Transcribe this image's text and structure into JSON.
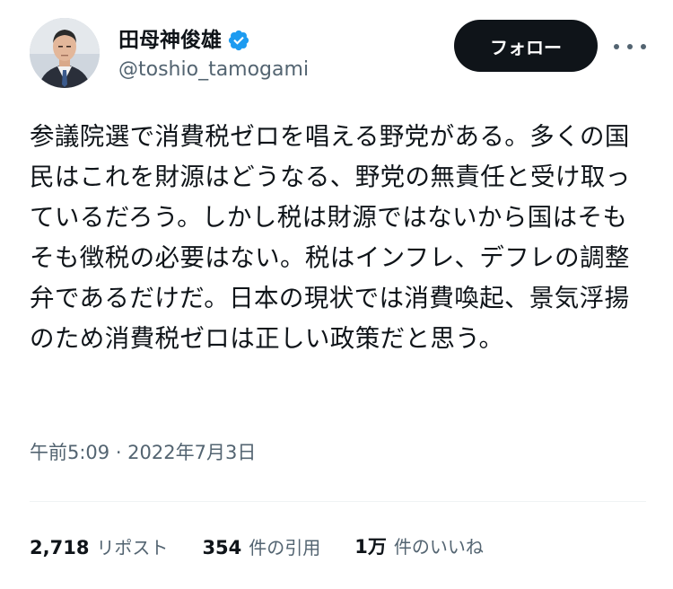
{
  "colors": {
    "text_primary": "#0f1419",
    "text_secondary": "#536471",
    "verified_badge": "#1d9bf0",
    "follow_button_bg": "#0f1419",
    "follow_button_text": "#ffffff",
    "divider": "#eff3f4"
  },
  "author": {
    "display_name": "田母神俊雄",
    "handle": "@toshio_tamogami",
    "verified": true,
    "verified_icon": "verified-badge-icon",
    "avatar": "profile-photo"
  },
  "actions": {
    "follow_label": "フォロー",
    "more_icon": "more-horizontal-icon"
  },
  "tweet": {
    "text": "参議院選で消費税ゼロを唱える野党がある。多くの国民はこれを財源はどうなる、野党の無責任と受け取っているだろう。しかし税は財源ではないから国はそもそも徴税の必要はない。税はインフレ、デフレの調整弁であるだけだ。日本の現状では消費喚起、景気浮揚のため消費税ゼロは正しい政策だと思う。",
    "timestamp": "午前5:09 · 2022年7月3日"
  },
  "stats": [
    {
      "value": "2,718",
      "label": "リポスト"
    },
    {
      "value": "354",
      "label": "件の引用"
    },
    {
      "value": "1万",
      "label": "件のいいね"
    }
  ]
}
